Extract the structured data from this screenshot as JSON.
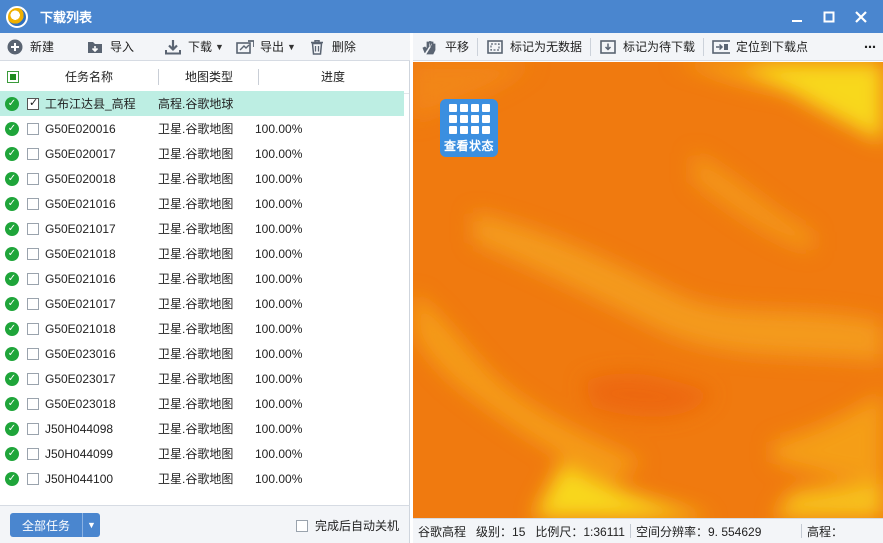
{
  "window": {
    "title": "下载列表",
    "controls": [
      "minimize",
      "maximize",
      "close"
    ]
  },
  "left_toolbar": {
    "new_label": "新建",
    "import_label": "导入",
    "download_label": "下载",
    "export_label": "导出",
    "delete_label": "删除"
  },
  "right_toolbar": {
    "pan_label": "平移",
    "mark_nodata_label": "标记为无数据",
    "mark_pending_label": "标记为待下载",
    "locate_label": "定位到下载点",
    "more_label": "⋯"
  },
  "table": {
    "headers": {
      "name": "任务名称",
      "type": "地图类型",
      "progress": "进度"
    },
    "rows": [
      {
        "name": "工布江达县_高程",
        "type": "高程.谷歌地球",
        "progress": "",
        "checked": true,
        "selected": true
      },
      {
        "name": "G50E020016",
        "type": "卫星.谷歌地图",
        "progress": "100.00%"
      },
      {
        "name": "G50E020017",
        "type": "卫星.谷歌地图",
        "progress": "100.00%"
      },
      {
        "name": "G50E020018",
        "type": "卫星.谷歌地图",
        "progress": "100.00%"
      },
      {
        "name": "G50E021016",
        "type": "卫星.谷歌地图",
        "progress": "100.00%"
      },
      {
        "name": "G50E021017",
        "type": "卫星.谷歌地图",
        "progress": "100.00%"
      },
      {
        "name": "G50E021018",
        "type": "卫星.谷歌地图",
        "progress": "100.00%"
      },
      {
        "name": "G50E021016",
        "type": "卫星.谷歌地图",
        "progress": "100.00%"
      },
      {
        "name": "G50E021017",
        "type": "卫星.谷歌地图",
        "progress": "100.00%"
      },
      {
        "name": "G50E021018",
        "type": "卫星.谷歌地图",
        "progress": "100.00%"
      },
      {
        "name": "G50E023016",
        "type": "卫星.谷歌地图",
        "progress": "100.00%"
      },
      {
        "name": "G50E023017",
        "type": "卫星.谷歌地图",
        "progress": "100.00%"
      },
      {
        "name": "G50E023018",
        "type": "卫星.谷歌地图",
        "progress": "100.00%"
      },
      {
        "name": "J50H044098",
        "type": "卫星.谷歌地图",
        "progress": "100.00%"
      },
      {
        "name": "J50H044099",
        "type": "卫星.谷歌地图",
        "progress": "100.00%"
      },
      {
        "name": "J50H044100",
        "type": "卫星.谷歌地图",
        "progress": "100.00%"
      }
    ]
  },
  "bottom": {
    "all_tasks_label": "全部任务",
    "shutdown_label": "完成后自动关机"
  },
  "map": {
    "view_status_label": "查看状态",
    "colors": {
      "base": "#f07a0f",
      "light": "#f6a418",
      "yellow": "#f8d81a",
      "dark": "#e85a0a"
    }
  },
  "statusbar": {
    "layer": "谷歌高程",
    "level": "级别：15",
    "scale": "比例尺：1:36111",
    "resolution": "空间分辨率：9. 554629",
    "elevation": "高程："
  },
  "colors": {
    "titlebar": "#4a86cf",
    "ok_green": "#1fa53a",
    "selected_row": "#bdeee3"
  }
}
